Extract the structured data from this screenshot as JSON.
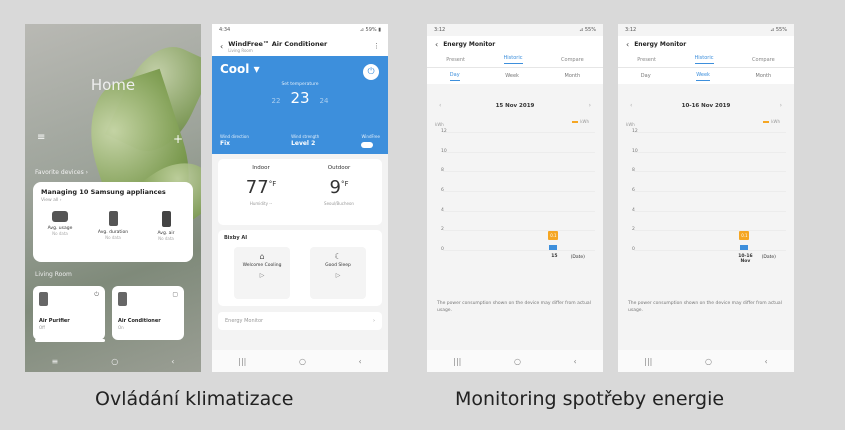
{
  "captions": {
    "left": "Ovládání klimatizace",
    "right": "Monitoring spotřeby energie"
  },
  "phone_home": {
    "status_time": "",
    "title": "Home",
    "favorites_label": "Favorite devices ›",
    "manage_title": "Managing 10 Samsung appliances",
    "manage_sub": "View all ›",
    "apps": [
      {
        "label": "Avg. usage",
        "sub": "No data",
        "icon": "tv-icon"
      },
      {
        "label": "Avg. duration",
        "sub": "No data",
        "icon": "device-icon"
      },
      {
        "label": "Avg. air",
        "sub": "No data",
        "icon": "ac-icon"
      }
    ],
    "room_label": "Living Room",
    "devices": [
      {
        "name": "Air Purifier",
        "status": "Off"
      },
      {
        "name": "Air Conditioner",
        "status": "On"
      }
    ]
  },
  "phone_ac": {
    "status_time": "4:34",
    "status_right": "⊿ 59% ▮",
    "title": "WindFree™ Air Conditioner",
    "subtitle": "Living Room",
    "mode": "Cool ▾",
    "set_label": "Set temperature",
    "temp_low": "22",
    "temp_main": "23",
    "temp_high": "24",
    "options": [
      {
        "label": "Wind direction",
        "value": "Fix"
      },
      {
        "label": "Wind strength",
        "value": "Level 2"
      },
      {
        "label": "WindFree",
        "value": ""
      }
    ],
    "indoor_label": "Indoor",
    "indoor_value": "77",
    "indoor_unit": "°F",
    "indoor_sub": "Humidity --",
    "outdoor_label": "Outdoor",
    "outdoor_value": "9",
    "outdoor_unit": "°F",
    "outdoor_sub": "Seoul/Bucheon",
    "bixby_title": "Bixby AI",
    "bixby_items": [
      {
        "label": "Welcome Cooling",
        "icon": "home-icon"
      },
      {
        "label": "Good Sleep",
        "icon": "moon-icon"
      }
    ],
    "energy_label": "Energy Monitor"
  },
  "phone_energy_day": {
    "status_time": "3:12",
    "status_right": "⊿ 55%",
    "title": "Energy Monitor",
    "tabs": [
      "Present",
      "Historic",
      "Compare"
    ],
    "subtabs": [
      "Day",
      "Week",
      "Month"
    ],
    "date": "15 Nov 2019",
    "legend": "kWh",
    "unit": "kWh",
    "bubble": "0.1",
    "x_label": "15",
    "x_unit": "(Date)",
    "note": "The power consumption shown on the device may differ from actual usage."
  },
  "phone_energy_week": {
    "status_time": "3:12",
    "status_right": "⊿ 55%",
    "title": "Energy Monitor",
    "tabs": [
      "Present",
      "Historic",
      "Compare"
    ],
    "subtabs": [
      "Day",
      "Week",
      "Month"
    ],
    "date": "10-16 Nov 2019",
    "legend": "kWh",
    "unit": "kWh",
    "bubble": "0.1",
    "x_label": "10-16 Nov",
    "x_unit": "(Date)",
    "note": "The power consumption shown on the device may differ from actual usage."
  },
  "chart_data": [
    {
      "type": "bar",
      "categories": [
        "15"
      ],
      "values": [
        0.1
      ],
      "ylim": [
        0,
        12
      ],
      "xlabel": "(Date)",
      "ylabel": "kWh",
      "yticks": [
        0,
        2,
        4,
        6,
        8,
        10,
        12
      ]
    },
    {
      "type": "bar",
      "categories": [
        "10-16 Nov"
      ],
      "values": [
        0.1
      ],
      "ylim": [
        0,
        12
      ],
      "xlabel": "(Date)",
      "ylabel": "kWh",
      "yticks": [
        0,
        2,
        4,
        6,
        8,
        10,
        12
      ]
    }
  ]
}
